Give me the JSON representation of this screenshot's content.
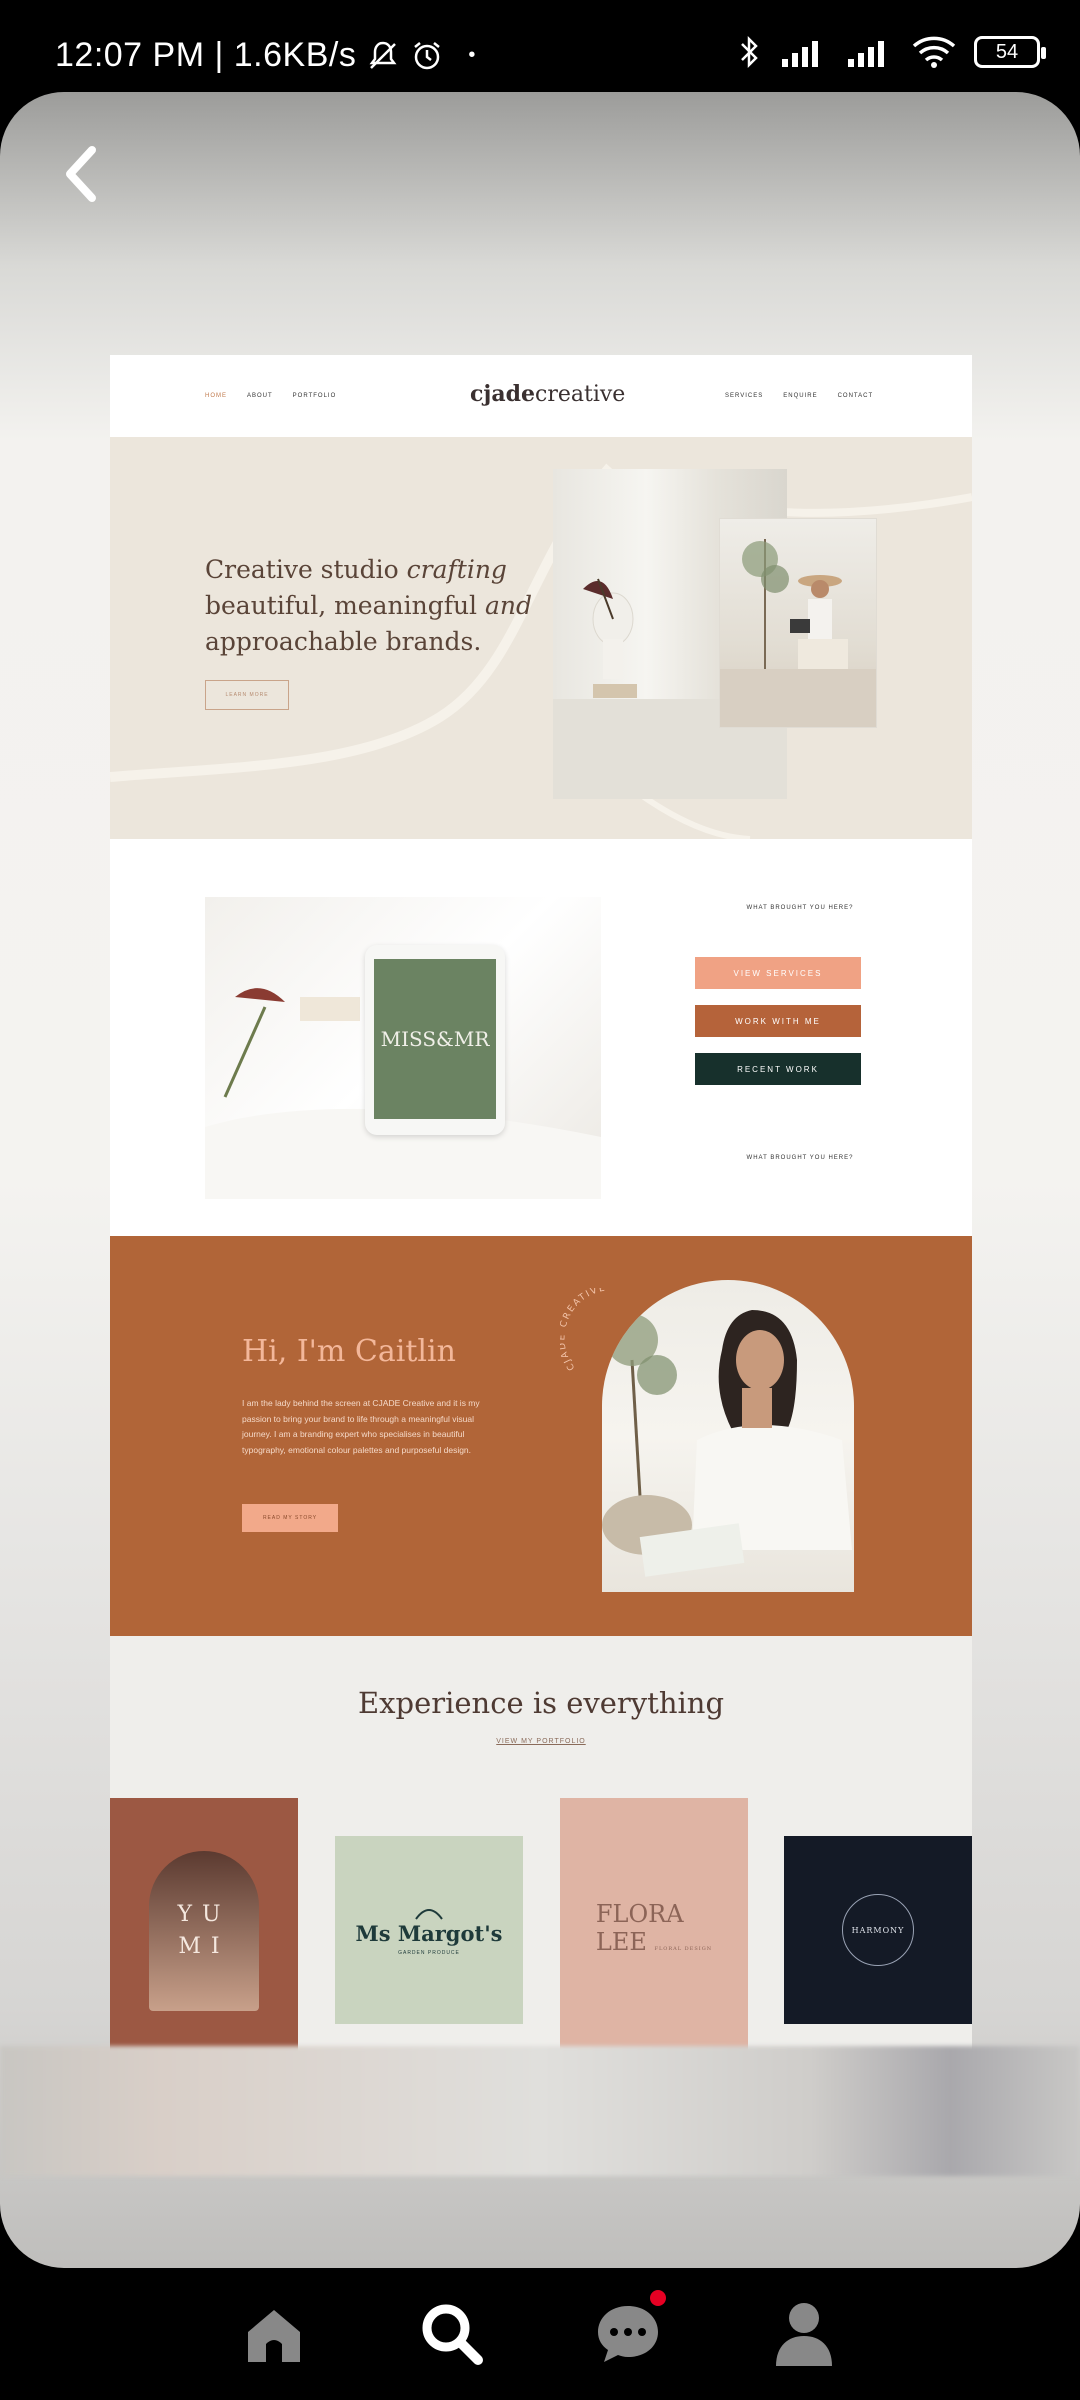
{
  "status_bar": {
    "time_speed": "12:07 PM | 1.6KB/s",
    "battery": "54"
  },
  "website": {
    "logo_bold": "cjade",
    "logo_light": "creative",
    "nav_left": [
      "HOME",
      "ABOUT",
      "PORTFOLIO"
    ],
    "nav_right": [
      "SERVICES",
      "ENQUIRE",
      "CONTACT"
    ],
    "hero": {
      "line1_a": "Creative studio ",
      "line1_b": "crafting",
      "line2_a": "beautiful, meaningful ",
      "line2_b": "and",
      "line3": "approachable brands.",
      "button": "LEARN MORE"
    },
    "mid": {
      "tablet_text": "MISS&MR",
      "question_top": "WHAT BROUGHT YOU HERE?",
      "question_bottom": "WHAT BROUGHT YOU HERE?",
      "buttons": [
        {
          "label": "VIEW SERVICES",
          "color": "#f0a284"
        },
        {
          "label": "WORK WITH ME",
          "color": "#b5633a"
        },
        {
          "label": "RECENT WORK",
          "color": "#17302c"
        }
      ]
    },
    "about": {
      "title": "Hi, I'm Caitlin",
      "body": "I am the lady behind the screen at CJADE Creative and it is my passion to bring your brand to life through a meaningful visual journey. I am a branding expert who specialises in beautiful typography, emotional colour palettes and purposeful design.",
      "button": "READ MY STORY",
      "arc_text": "CJADE CREATIVE"
    },
    "experience": {
      "title": "Experience is everything",
      "link": "VIEW MY PORTFOLIO",
      "tiles": {
        "yumi": "YUMI",
        "margot": "Ms Margot's",
        "margot_sub": "GARDEN PRODUCE",
        "flora_1": "FLORA",
        "flora_2": "LEE",
        "flora_sub": "FLORAL DESIGN",
        "harmony": "HARMONY"
      }
    }
  },
  "colors": {
    "hero_bg": "#ece6dc",
    "about_bg": "#b16538",
    "accent_peach": "#f0a284",
    "dark_green": "#17302c"
  }
}
